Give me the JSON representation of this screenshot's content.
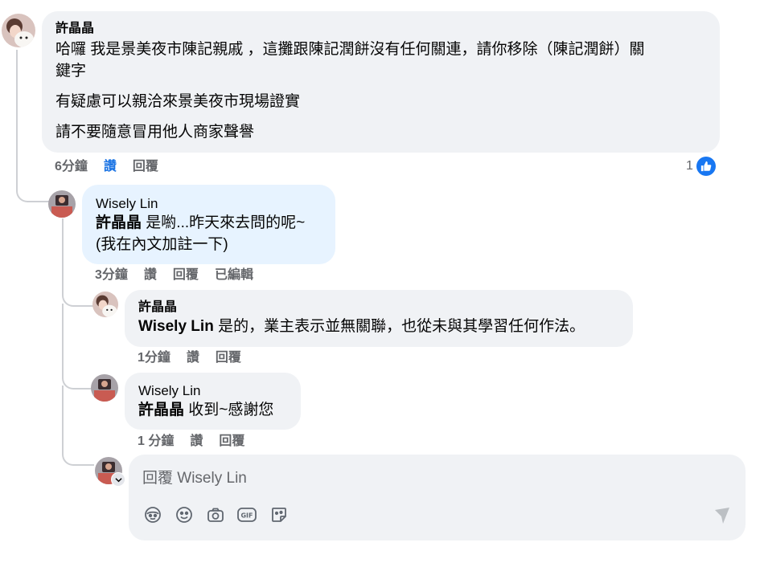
{
  "comments": [
    {
      "author": "許晶晶",
      "paragraphs": [
        "哈囉 我是景美夜市陳記親戚 ，這攤跟陳記潤餅沒有任何關連，請你移除（陳記潤餅）關",
        "鍵字",
        "有疑慮可以親洽來景美夜市現場證實",
        "請不要隨意冒用他人商家聲譽"
      ],
      "time": "6分鐘",
      "like_label": "讚",
      "reply_label": "回覆",
      "like_count": "1"
    },
    {
      "author": "Wisely Lin",
      "mention": "許晶晶",
      "line1": " 是喲...昨天來去問的呢~",
      "line2": "(我在內文加註一下)",
      "time": "3分鐘",
      "like_label": "讚",
      "reply_label": "回覆",
      "edited_label": "已編輯"
    },
    {
      "author": "許晶晶",
      "mention": "Wisely Lin",
      "line1": " 是的，業主表示並無關聯，也從未與其學習任何作法。",
      "time": "1分鐘",
      "like_label": "讚",
      "reply_label": "回覆"
    },
    {
      "author": "Wisely Lin",
      "mention": "許晶晶",
      "line1": " 收到~感謝您",
      "time": "1 分鐘",
      "like_label": "讚",
      "reply_label": "回覆"
    }
  ],
  "composer": {
    "placeholder": "回覆 Wisely Lin",
    "tools": [
      "avatar-sticker-icon",
      "emoji-icon",
      "camera-icon",
      "gif-icon",
      "sticker-icon"
    ],
    "send_icon": "send-icon"
  },
  "colors": {
    "bubble": "#f0f2f5",
    "bubble_highlight": "#e7f3ff",
    "accent": "#1877f2",
    "liked_text": "#1b74e4",
    "meta_text": "#65676b"
  }
}
